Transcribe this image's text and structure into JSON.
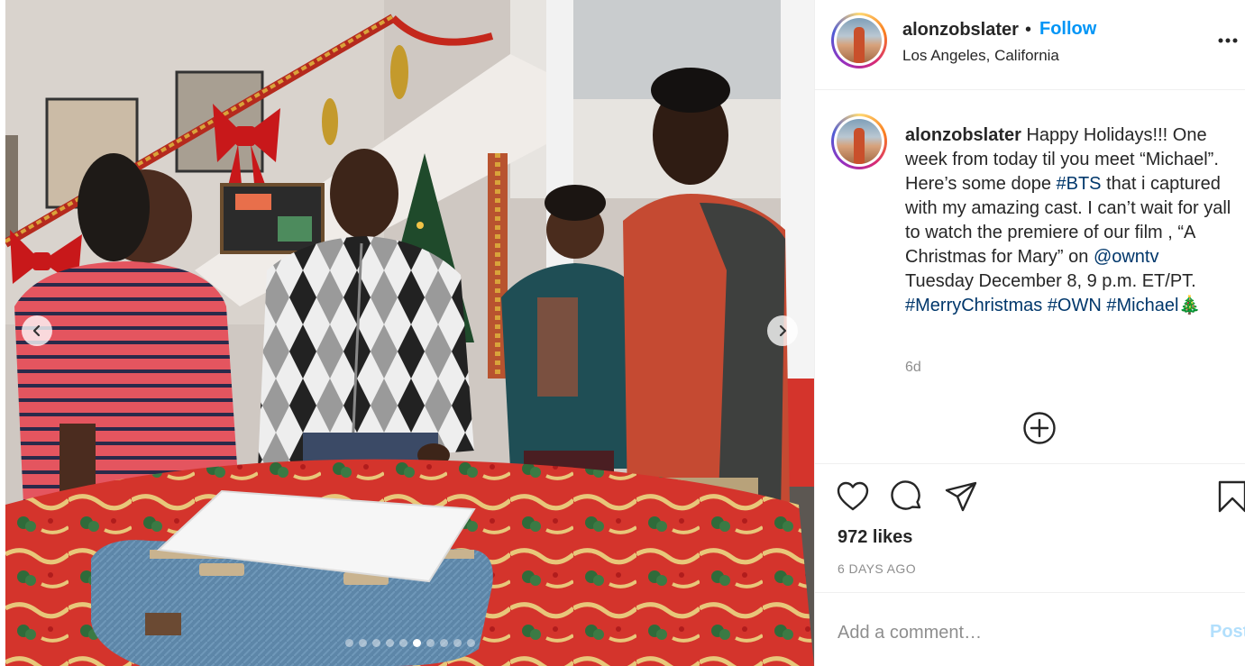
{
  "post": {
    "username": "alonzobslater",
    "separator": "•",
    "follow_label": "Follow",
    "location": "Los Angeles, California",
    "caption_prefix": "Happy Holidays!!! One week from today til you meet “Michael”. Here’s some dope ",
    "tag_bts": "#BTS",
    "caption_mid1": " that i captured with my amazing cast. I can’t wait for yall to watch the premiere of our film , “A Christmas for Mary” on ",
    "mention_owntv": "@owntv",
    "caption_mid2": " Tuesday December 8, 9 p.m. ET/PT. ",
    "tag_merry": "#MerryChristmas",
    "tag_own": "#OWN",
    "tag_michael": "#Michael",
    "emoji": "🎄",
    "caption_time": "6d",
    "likes": "972 likes",
    "date": "6 DAYS AGO",
    "comment_placeholder": "Add a comment…",
    "post_label": "Post"
  },
  "carousel": {
    "total": 10,
    "active_index": 5
  },
  "icons": {
    "more": "more-options-icon",
    "plus": "add-circle-icon",
    "like": "heart-icon",
    "comment": "comment-bubble-icon",
    "share": "paper-plane-icon",
    "save": "bookmark-icon",
    "prev": "chevron-left-icon",
    "next": "chevron-right-icon"
  },
  "colors": {
    "follow": "#0095f6",
    "hashtag": "#00376b",
    "post_disabled": "#b2dffc",
    "muted": "#8e8e8e"
  }
}
